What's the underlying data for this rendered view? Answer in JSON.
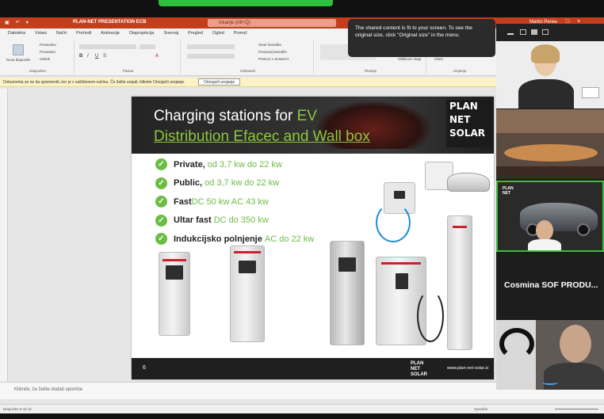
{
  "ppt": {
    "doc_title": "PLAN-NET PRESENTATION ECB",
    "search_placeholder": "Iskanje (Alt+Q)",
    "user_name": "Marko Perec",
    "user_initials": "MP",
    "tabs": [
      "Datoteka",
      "Vstavi",
      "Načrt",
      "Prehodi",
      "Animacije",
      "Diaprojekcija",
      "Snemaj",
      "Pregled",
      "Ogled",
      "Pomoč"
    ],
    "ribbon_groups": [
      "Diapozitivi",
      "Pisava",
      "Odstavek",
      "Risanje",
      "Urejanje"
    ],
    "ribbon_new_slide": "Nova diapozitiv",
    "ribbon_items": [
      "Postavitev",
      "Ponastavi",
      "Odsek",
      "Smer besedila",
      "Poravnaj besedilo",
      "Pretvori v SmartArt",
      "Oblikovni slogi",
      "Najdi",
      "Zamenjaj",
      "Izberi"
    ],
    "message": "Dokumenta se ne da spremeniti, ker je v zaščitenem načinu. Če želite urejati, kliknite Omogoči urejanje.",
    "message_button": "Omogoči urejanje",
    "notes_placeholder": "Kliknite, če želite dodati opombe",
    "status_left": "Diapozitiv 6 od 12",
    "status_notes": "Opombe"
  },
  "slide": {
    "title_part1": "Charging stations for ",
    "title_ev": "EV",
    "title_line2": "Distribution Efacec and Wall box",
    "brand_lines": [
      "PLAN",
      "NET",
      "SOLAR"
    ],
    "bullets": [
      {
        "bold": "Private,",
        "rest": "od 3,7 kw do 22 kw"
      },
      {
        "bold": "Public,",
        "rest": "od 3,7 kw do 22 kw"
      },
      {
        "bold": "Fast",
        "rest": "DC 50 kw AC 43 kw"
      },
      {
        "bold": "Ultar fast",
        "rest": "DC  do 350 kw"
      },
      {
        "bold": "Indukcijsko polnjenje",
        "rest": "AC  do 22 kw"
      }
    ],
    "page_number": "6",
    "footer_logo": [
      "PLAN",
      "NET",
      "SOLAR"
    ],
    "footer_url": "www.plan-net-solar.si"
  },
  "tooltip": {
    "text": "The shared content is fit to your screen. To see the original size, click \"Original size\" in the menu."
  },
  "zoom": {
    "participant_name": "Cosmina SOF PRODU...",
    "pip_logo": [
      "PLAN",
      "NET"
    ]
  },
  "colors": {
    "ppt_red": "#c43e1c",
    "accent_green": "#8dc63f",
    "check_green": "#6cbd45",
    "active_speaker": "#3cbf3a"
  }
}
